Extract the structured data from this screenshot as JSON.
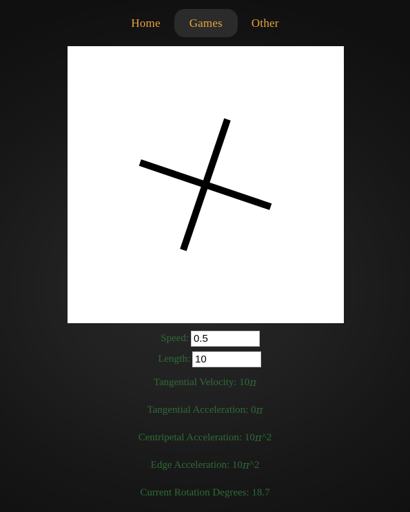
{
  "nav": {
    "items": [
      {
        "label": "Home",
        "active": false
      },
      {
        "label": "Games",
        "active": true
      },
      {
        "label": "Other",
        "active": false
      }
    ]
  },
  "canvas": {
    "background_color": "#ffffff",
    "stroke_color": "#000000",
    "rotation_degrees": 18.7,
    "bar_thickness": 10,
    "bar_half_length": 100
  },
  "controls": {
    "speed": {
      "label": "Speed:",
      "value": "0.5",
      "placeholder": "Speed"
    },
    "length": {
      "label": "Length:",
      "value": "10",
      "placeholder": "Length"
    }
  },
  "readouts": {
    "tangential_velocity": "Tangential Velocity: 10π",
    "tangential_acceleration": "Tangential Acceleration: 0π",
    "centripetal_acceleration": "Centripetal Acceleration: 10π^2",
    "edge_acceleration": "Edge Acceleration: 10π^2",
    "current_rotation_degrees": "Current Rotation Degrees: 18.7"
  },
  "colors": {
    "nav_text": "#e8a33d",
    "nav_active_bg": "#2b2b2b",
    "readout_text": "#2f6b38",
    "page_bg": "#131313"
  }
}
